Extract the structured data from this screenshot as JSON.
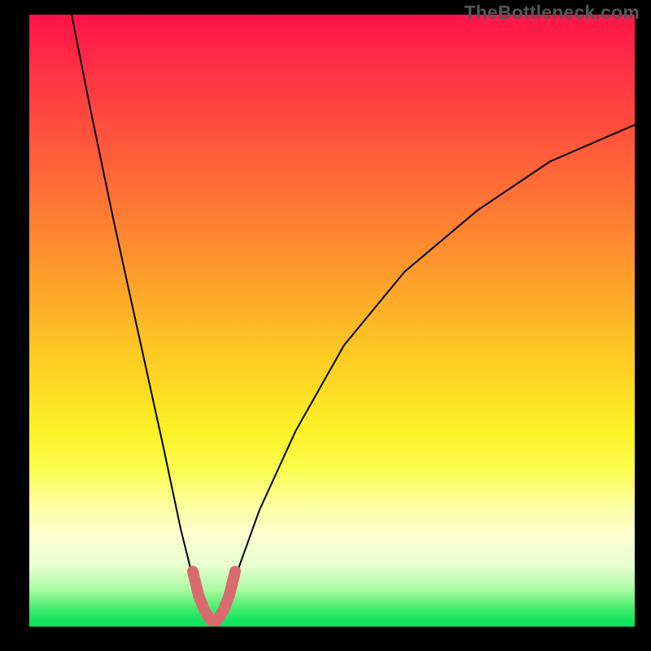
{
  "watermark": "TheBottleneck.com",
  "chart_data": {
    "type": "line",
    "title": "",
    "xlabel": "",
    "ylabel": "",
    "xlim": [
      0,
      100
    ],
    "ylim": [
      0,
      100
    ],
    "grid": false,
    "legend": false,
    "series": [
      {
        "name": "bottleneck-curve",
        "x": [
          7,
          10,
          14,
          18,
          22,
          25,
          27,
          29,
          30.5,
          32,
          34,
          38,
          44,
          52,
          62,
          74,
          86,
          100
        ],
        "y": [
          100,
          85,
          66,
          48,
          30,
          16,
          8,
          3,
          1,
          3,
          8,
          19,
          32,
          46,
          58,
          68,
          76,
          82
        ],
        "color": "#000000",
        "stroke_width": 2
      },
      {
        "name": "optimal-zone-marker",
        "x": [
          27,
          28,
          29,
          30,
          31,
          32,
          33,
          34
        ],
        "y": [
          9,
          5,
          2.5,
          1,
          1,
          2.5,
          5,
          9
        ],
        "color": "#d86b6d",
        "stroke_width": 14,
        "linecap": "round"
      }
    ],
    "annotations": []
  },
  "colors": {
    "gradient_top": "#ff1348",
    "gradient_mid": "#fdf226",
    "gradient_bottom": "#0fe15e",
    "frame": "#000000",
    "marker": "#d86b6d"
  }
}
